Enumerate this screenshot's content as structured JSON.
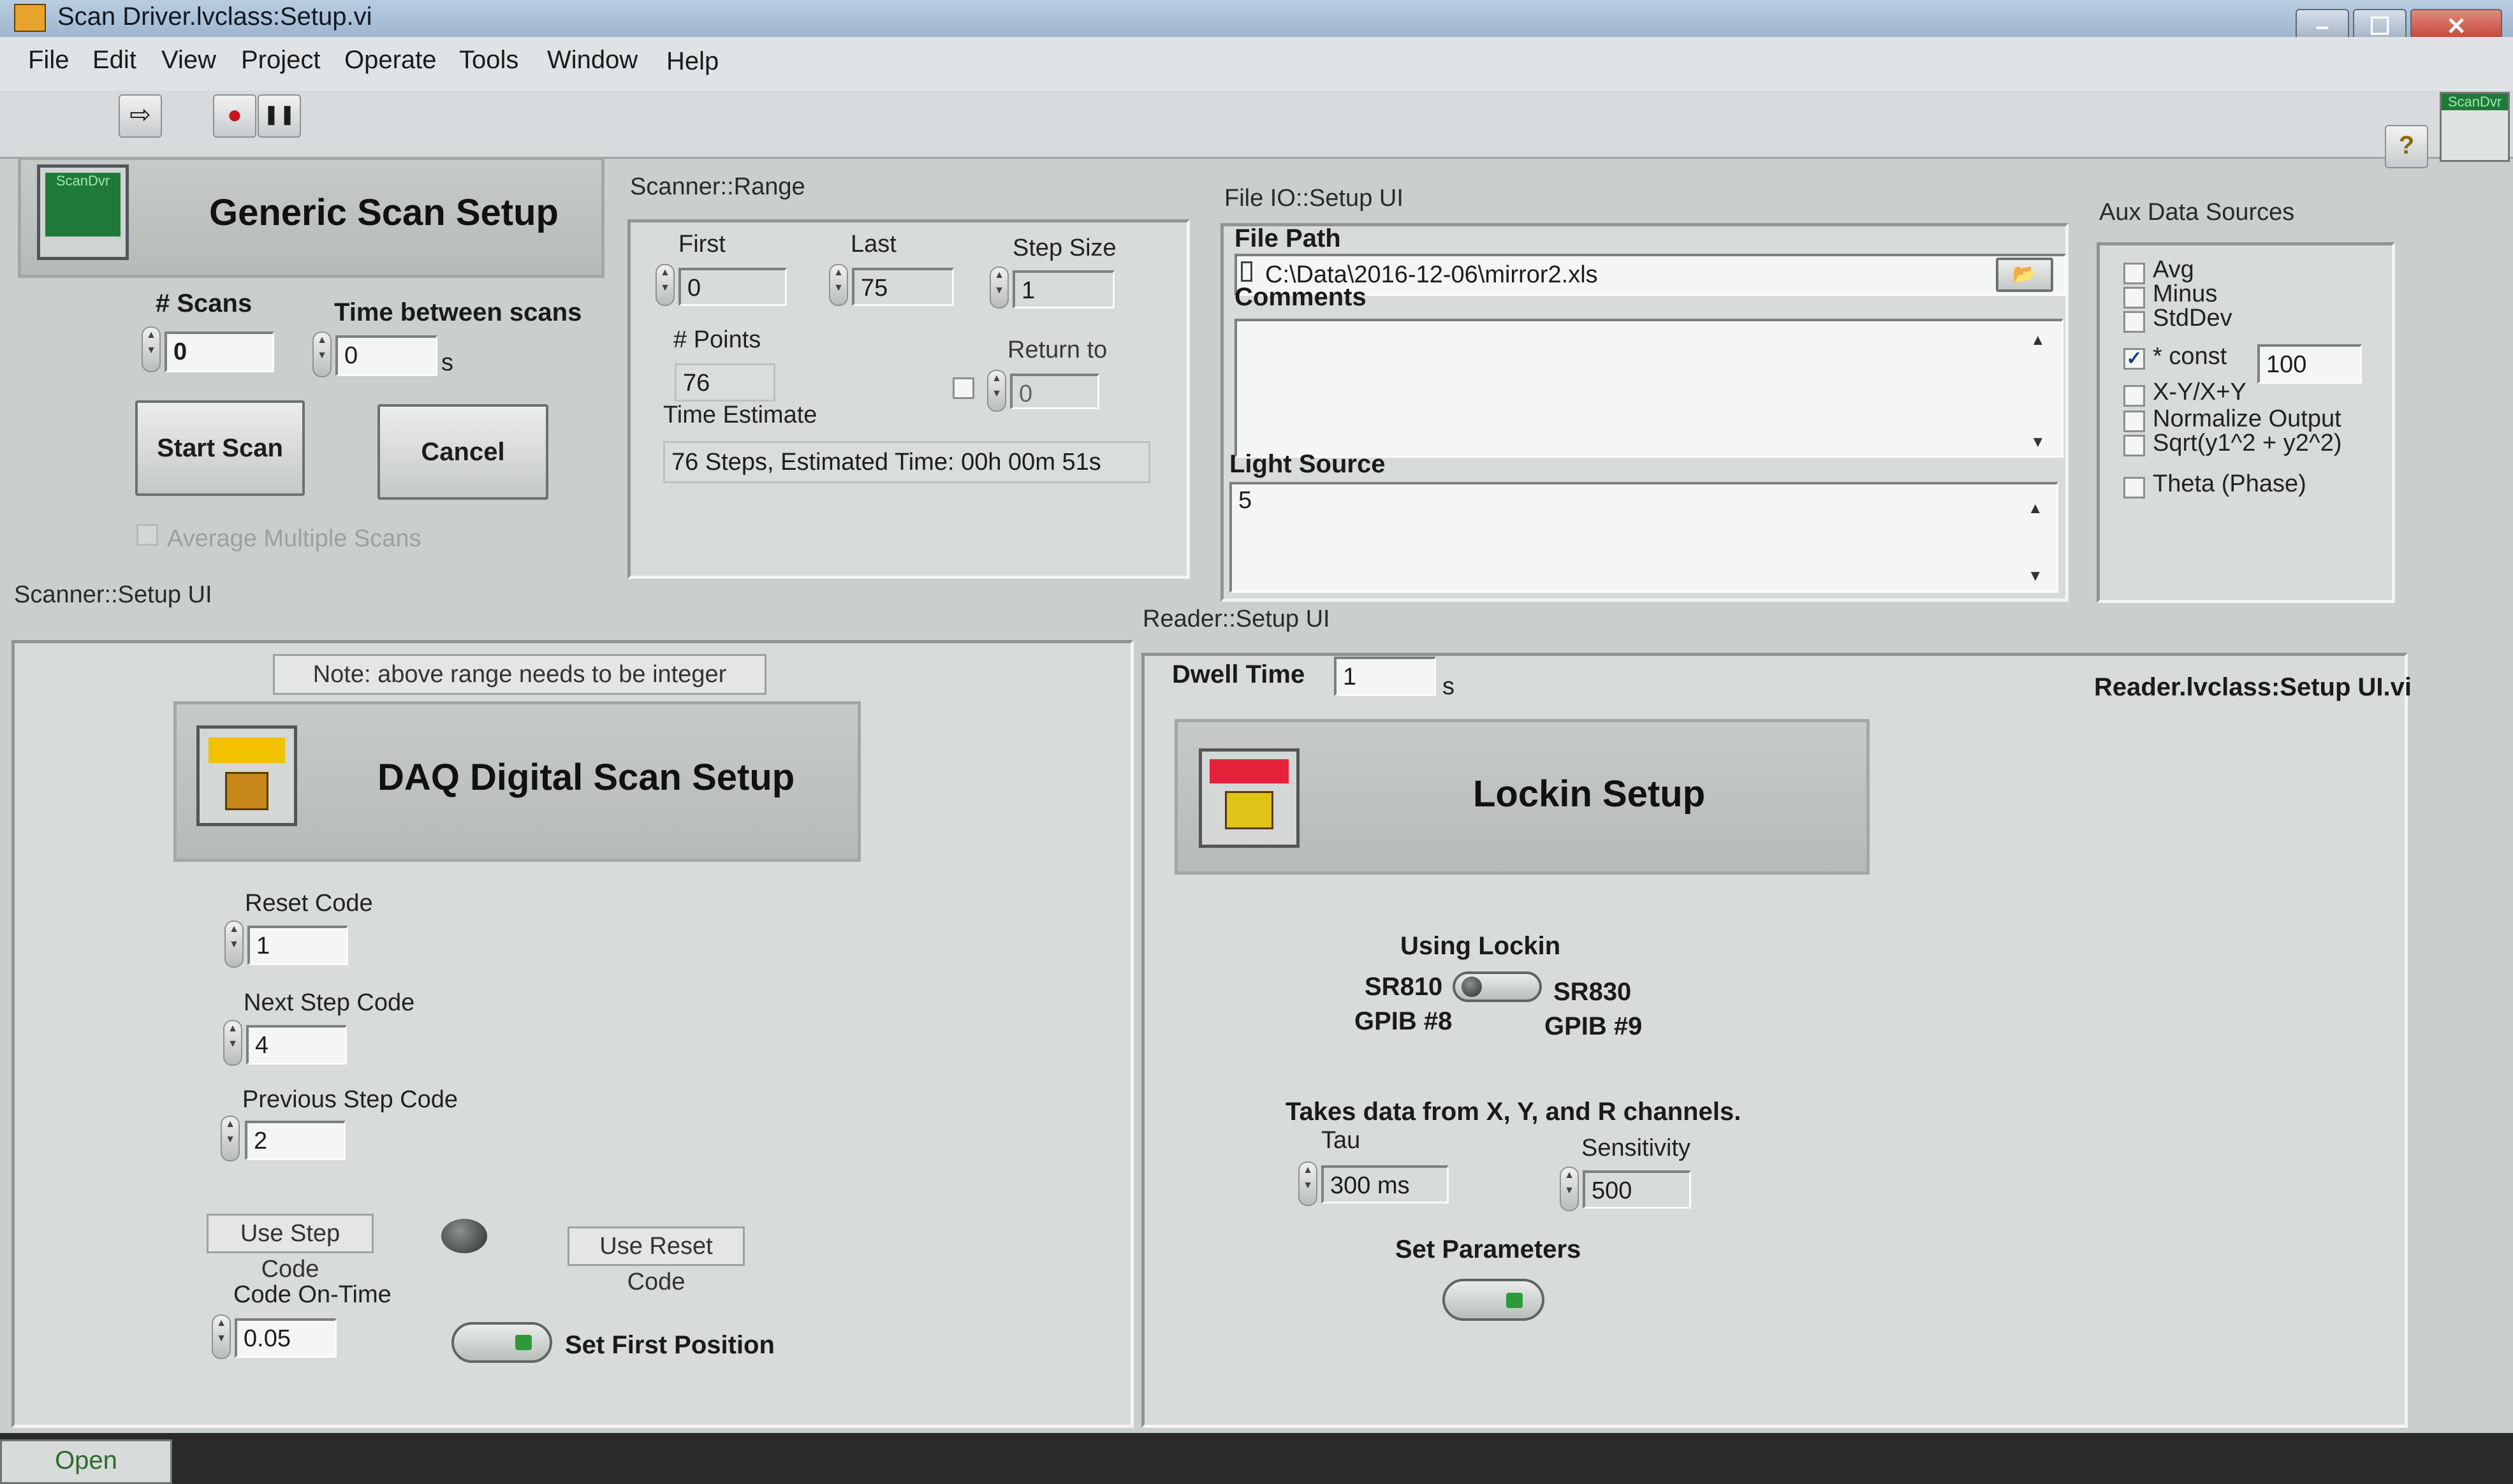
{
  "window": {
    "title": "Scan Driver.lvclass:Setup.vi",
    "min": "–",
    "max": "☐",
    "close": "✕"
  },
  "menu": [
    "File",
    "Edit",
    "View",
    "Project",
    "Operate",
    "Tools",
    "Window",
    "Help"
  ],
  "toolbar": {
    "run_glyph": "⇨",
    "abort_glyph": "●",
    "pause_glyph": "❚❚",
    "help_glyph": "?",
    "vi_icon_label": "ScanDvr"
  },
  "generic": {
    "title": "Generic Scan Setup",
    "icon_label": "ScanDvr",
    "scans_label": "# Scans",
    "scans_value": "0",
    "time_label": "Time between scans",
    "time_value": "0",
    "time_unit": "s",
    "start_label": "Start Scan",
    "cancel_label": "Cancel",
    "average_label": "Average Multiple Scans"
  },
  "scanner_range": {
    "caption": "Scanner::Range",
    "first_label": "First",
    "first_value": "0",
    "last_label": "Last",
    "last_value": "75",
    "step_label": "Step Size",
    "step_value": "1",
    "points_label": "# Points",
    "points_value": "76",
    "return_label": "Return to",
    "return_value": "0",
    "time_est_label": "Time Estimate",
    "time_est_value": "76 Steps, Estimated Time: 00h 00m 51s"
  },
  "fileio": {
    "caption": "File IO::Setup UI",
    "path_label": "File Path",
    "path_value": "C:\\Data\\2016-12-06\\mirror2.xls",
    "comments_label": "Comments",
    "comments_value": "",
    "light_label": "Light Source",
    "light_value": "5"
  },
  "aux": {
    "caption": "Aux Data Sources",
    "items": [
      {
        "label": "Avg",
        "checked": false
      },
      {
        "label": "Minus",
        "checked": false
      },
      {
        "label": "StdDev",
        "checked": false
      },
      {
        "label": "* const",
        "checked": true
      },
      {
        "label": "X-Y/X+Y",
        "checked": false
      },
      {
        "label": "Normalize Output",
        "checked": false
      },
      {
        "label": "Sqrt(y1^2 + y2^2)",
        "checked": false
      },
      {
        "label": "Theta (Phase)",
        "checked": false
      }
    ],
    "const_value": "100"
  },
  "scanner_setup": {
    "caption": "Scanner::Setup UI",
    "note": "Note: above range needs to be integer values",
    "title": "DAQ Digital Scan Setup",
    "reset_label": "Reset Code",
    "reset_value": "1",
    "next_label": "Next Step Code",
    "next_value": "4",
    "prev_label": "Previous Step Code",
    "prev_value": "2",
    "use_step_label": "Use Step Code",
    "use_reset_label": "Use Reset Code",
    "ontime_label": "Code On-Time",
    "ontime_value": "0.05",
    "set_first_label": "Set First Position"
  },
  "reader": {
    "caption": "Reader::Setup UI",
    "dwell_label": "Dwell Time",
    "dwell_value": "1",
    "dwell_unit": "s",
    "vi_name": "Reader.lvclass:Setup UI.vi",
    "title": "Lockin Setup",
    "using_label": "Using Lockin",
    "sr810": "SR810",
    "sr830": "SR830",
    "gpib8": "GPIB #8",
    "gpib9": "GPIB #9",
    "takes_data": "Takes data from X, Y, and R channels.",
    "tau_label": "Tau",
    "tau_value": "300 ms",
    "sens_label": "Sensitivity",
    "sens_value": "500",
    "set_params_label": "Set Parameters"
  },
  "status": {
    "open_label": "Open"
  },
  "colors": {
    "panel_bg": "#d3d7d5",
    "window_bg": "#c9cfcc",
    "led_green": "#2e6b2e",
    "abort_red": "#c8141e"
  }
}
